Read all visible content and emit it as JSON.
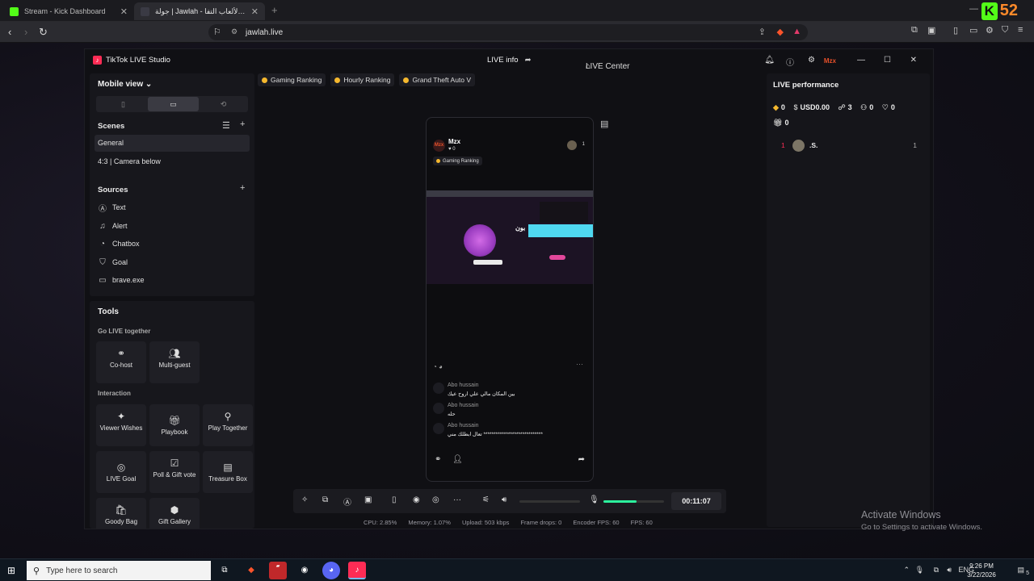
{
  "browser": {
    "tabs": [
      {
        "title": "Stream - Kick Dashboard"
      },
      {
        "title": "جولة | Jawlah - منصة الألعاب التفا"
      }
    ],
    "url": "jawlah.live",
    "badge_number": "52"
  },
  "studio": {
    "app_name": "TikTok LIVE Studio",
    "live_info": "LIVE info",
    "live_center": "LIVE Center",
    "brand_mark": "Mzx"
  },
  "left_panel": {
    "view_label": "Mobile view",
    "scenes_heading": "Scenes",
    "scenes": [
      "General",
      "4:3 | Camera below"
    ],
    "sources_heading": "Sources",
    "sources": [
      {
        "label": "Text",
        "icon": "text-icon"
      },
      {
        "label": "Alert",
        "icon": "bell-icon"
      },
      {
        "label": "Chatbox",
        "icon": "chat-icon"
      },
      {
        "label": "Goal",
        "icon": "shield-icon"
      },
      {
        "label": "brave.exe",
        "icon": "window-icon"
      }
    ]
  },
  "tools": {
    "heading": "Tools",
    "go_live_together": "Go LIVE together",
    "interaction": "Interaction",
    "go_live_items": [
      {
        "label": "Co-host",
        "icon": "link-icon"
      },
      {
        "label": "Multi-guest",
        "icon": "users-icon"
      }
    ],
    "interaction_items": [
      {
        "label": "Viewer Wishes",
        "icon": "wish-icon"
      },
      {
        "label": "Playbook",
        "icon": "gift-icon"
      },
      {
        "label": "Play Together",
        "icon": "joystick-icon"
      },
      {
        "label": "LIVE Goal",
        "icon": "target-icon"
      },
      {
        "label": "Poll & Gift vote",
        "icon": "poll-icon"
      },
      {
        "label": "Treasure Box",
        "icon": "treasure-icon"
      },
      {
        "label": "Goody Bag",
        "icon": "bag-icon"
      },
      {
        "label": "Gift Gallery",
        "icon": "gallery-icon"
      }
    ]
  },
  "ranking_tags": [
    "Gaming Ranking",
    "Hourly Ranking",
    "Grand Theft Auto V"
  ],
  "preview": {
    "streamer": "Mzx",
    "likes": "0",
    "viewers": "1",
    "ranking_badge": "Gaming Ranking",
    "screen_title": "بون",
    "chat": [
      {
        "user": "Abo hussain",
        "message": "بين المكان مالي علي اروح عيك"
      },
      {
        "user": "Abo hussain",
        "message": "حله"
      },
      {
        "user": "Abo hussain",
        "message": "تعال ابطلك مني *****************************"
      }
    ]
  },
  "controls": {
    "timer": "00:11:07",
    "mic_level": 0.55
  },
  "stats": {
    "cpu": "CPU: 2.85%",
    "memory": "Memory: 1.07%",
    "upload": "Upload: 503 kbps",
    "frame_drops": "Frame drops: 0",
    "encoder_fps": "Encoder FPS: 60",
    "fps": "FPS: 60"
  },
  "live_performance": {
    "heading": "LIVE performance",
    "diamonds": "0",
    "usd": "USD0.00",
    "viewers": "3",
    "new_followers": "0",
    "likes": "0",
    "gifters": "0",
    "ranking": [
      {
        "rank": "1",
        "name": ".S.",
        "score": "1"
      }
    ]
  },
  "activation": {
    "title": "Activate Windows",
    "subtitle": "Go to Settings to activate Windows."
  },
  "taskbar": {
    "search_placeholder": "Type here to search",
    "time": "9:26 PM",
    "date": "3/22/2026",
    "language": "ENG",
    "notification_count": "5"
  },
  "colors": {
    "kick_green": "#53fc18",
    "tiktok_red": "#fe2c55",
    "mic_green": "#2cf29d",
    "gold": "#f5b82e"
  }
}
